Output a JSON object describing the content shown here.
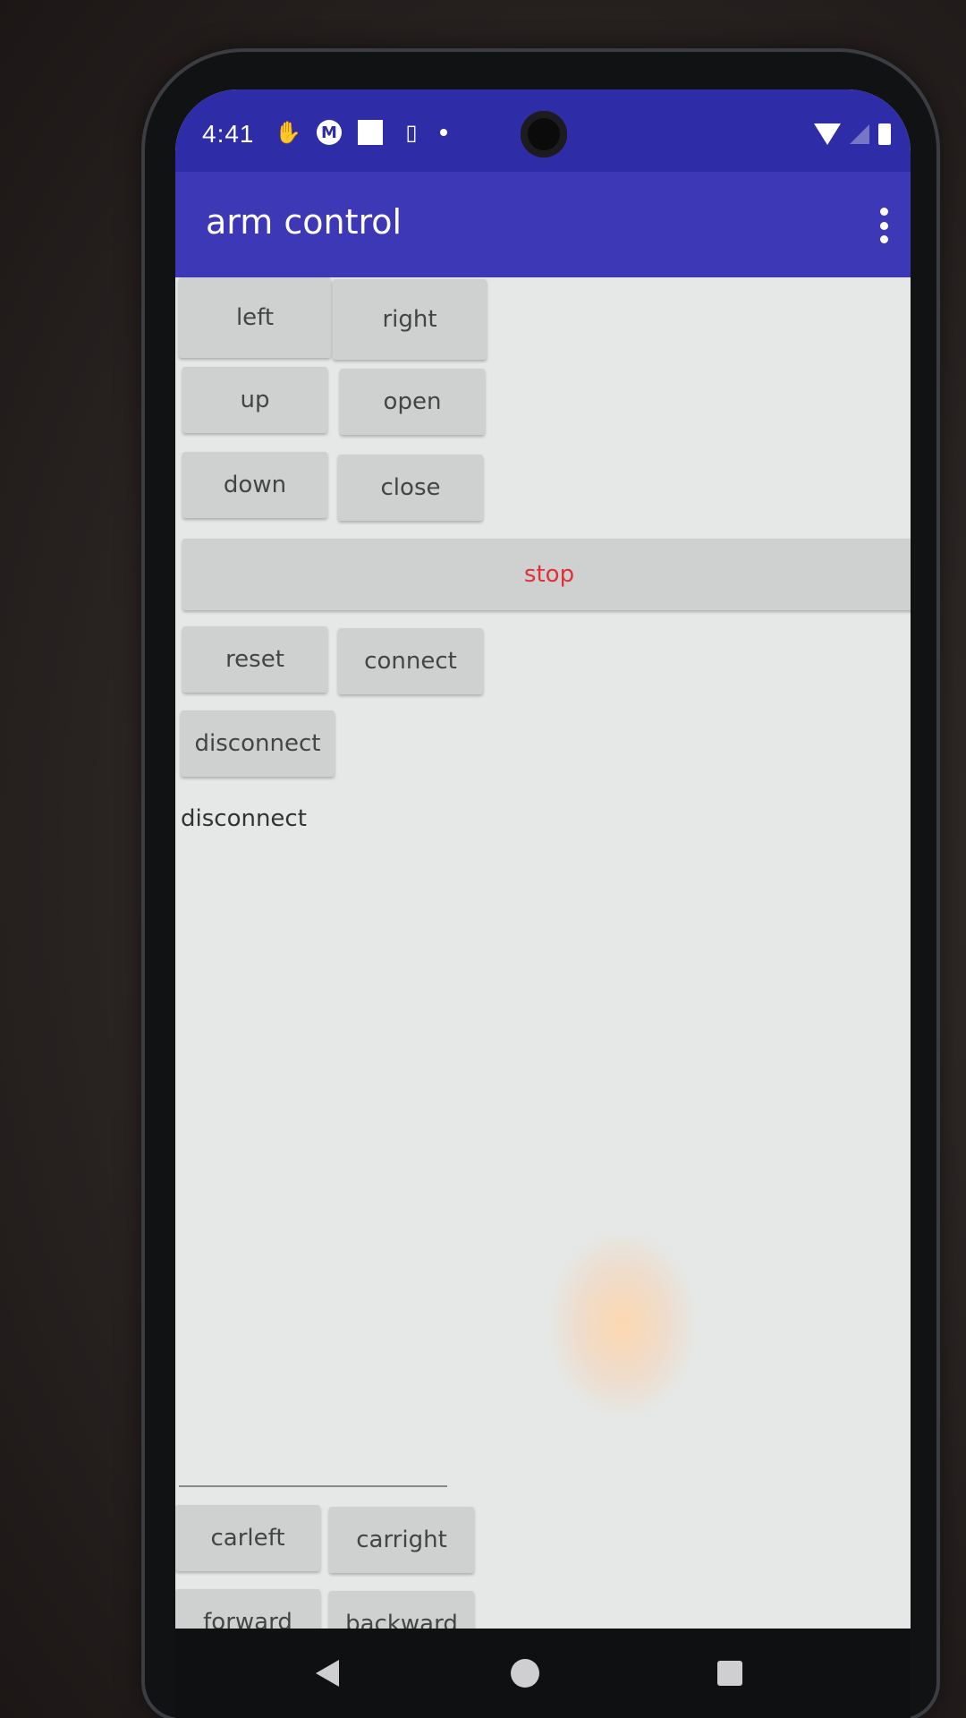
{
  "status_bar": {
    "time": "4:41",
    "left_icons": [
      "hand-icon",
      "motorola-icon",
      "square-icon",
      "phone-icon",
      "dot-icon"
    ],
    "right_icons": [
      "wifi-icon",
      "signal-icon",
      "battery-icon"
    ]
  },
  "app_bar": {
    "title": "arm control",
    "menu_icon": "overflow-menu-icon"
  },
  "buttons": {
    "left": "left",
    "right": "right",
    "up": "up",
    "open": "open",
    "down": "down",
    "close": "close",
    "stop": "stop",
    "reset": "reset",
    "connect": "connect",
    "disconnect": "disconnect",
    "carleft": "carleft",
    "carright": "carright",
    "forward": "forward",
    "backward": "backward"
  },
  "connection_status": "disconnect",
  "colors": {
    "status_bar": "#2f2ca8",
    "app_bar": "#3c38b6",
    "button_bg": "#cfd1d0",
    "stop_text": "#e0303a",
    "screen_bg": "#e5e8e6"
  },
  "nav_bar": {
    "icons": [
      "back-icon",
      "home-icon",
      "recents-icon"
    ]
  }
}
